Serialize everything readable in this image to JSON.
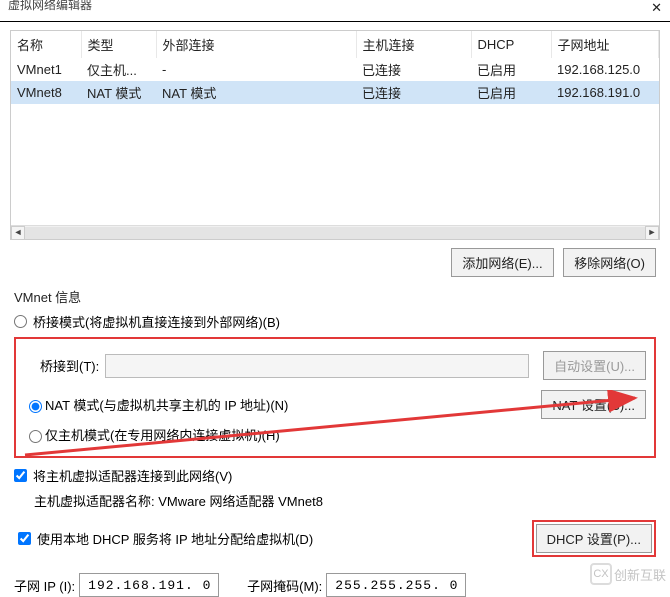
{
  "window": {
    "title": "虚拟网络编辑器",
    "close_glyph": "✕"
  },
  "table": {
    "headers": [
      "名称",
      "类型",
      "外部连接",
      "主机连接",
      "DHCP",
      "子网地址"
    ],
    "rows": [
      {
        "name": "VMnet1",
        "type": "仅主机...",
        "ext": "-",
        "host": "已连接",
        "dhcp": "已启用",
        "subnet": "192.168.125.0",
        "selected": false
      },
      {
        "name": "VMnet8",
        "type": "NAT 模式",
        "ext": "NAT 模式",
        "host": "已连接",
        "dhcp": "已启用",
        "subnet": "192.168.191.0",
        "selected": true
      }
    ]
  },
  "buttons": {
    "add_network": "添加网络(E)...",
    "remove_network": "移除网络(O)"
  },
  "info_section": {
    "label": "VMnet 信息",
    "radio_bridged": "桥接模式(将虚拟机直接连接到外部网络)(B)",
    "bridged_to_label": "桥接到(T):",
    "auto_settings": "自动设置(U)...",
    "radio_nat": "NAT 模式(与虚拟机共享主机的 IP 地址)(N)",
    "nat_settings": "NAT 设置(S)...",
    "radio_hostonly": "仅主机模式(在专用网络内连接虚拟机)(H)"
  },
  "host_adapter": {
    "check_label": "将主机虚拟适配器连接到此网络(V)",
    "adapter_label": "主机虚拟适配器名称: VMware 网络适配器 VMnet8"
  },
  "dhcp": {
    "check_label": "使用本地 DHCP 服务将 IP 地址分配给虚拟机(D)",
    "settings_btn": "DHCP 设置(P)..."
  },
  "ip": {
    "subnet_ip_label": "子网 IP (I):",
    "subnet_ip_value": "192.168.191. 0",
    "mask_label": "子网掩码(M):",
    "mask_value": "255.255.255. 0"
  },
  "watermark": {
    "icon_text": "CX",
    "text": "创新互联"
  }
}
